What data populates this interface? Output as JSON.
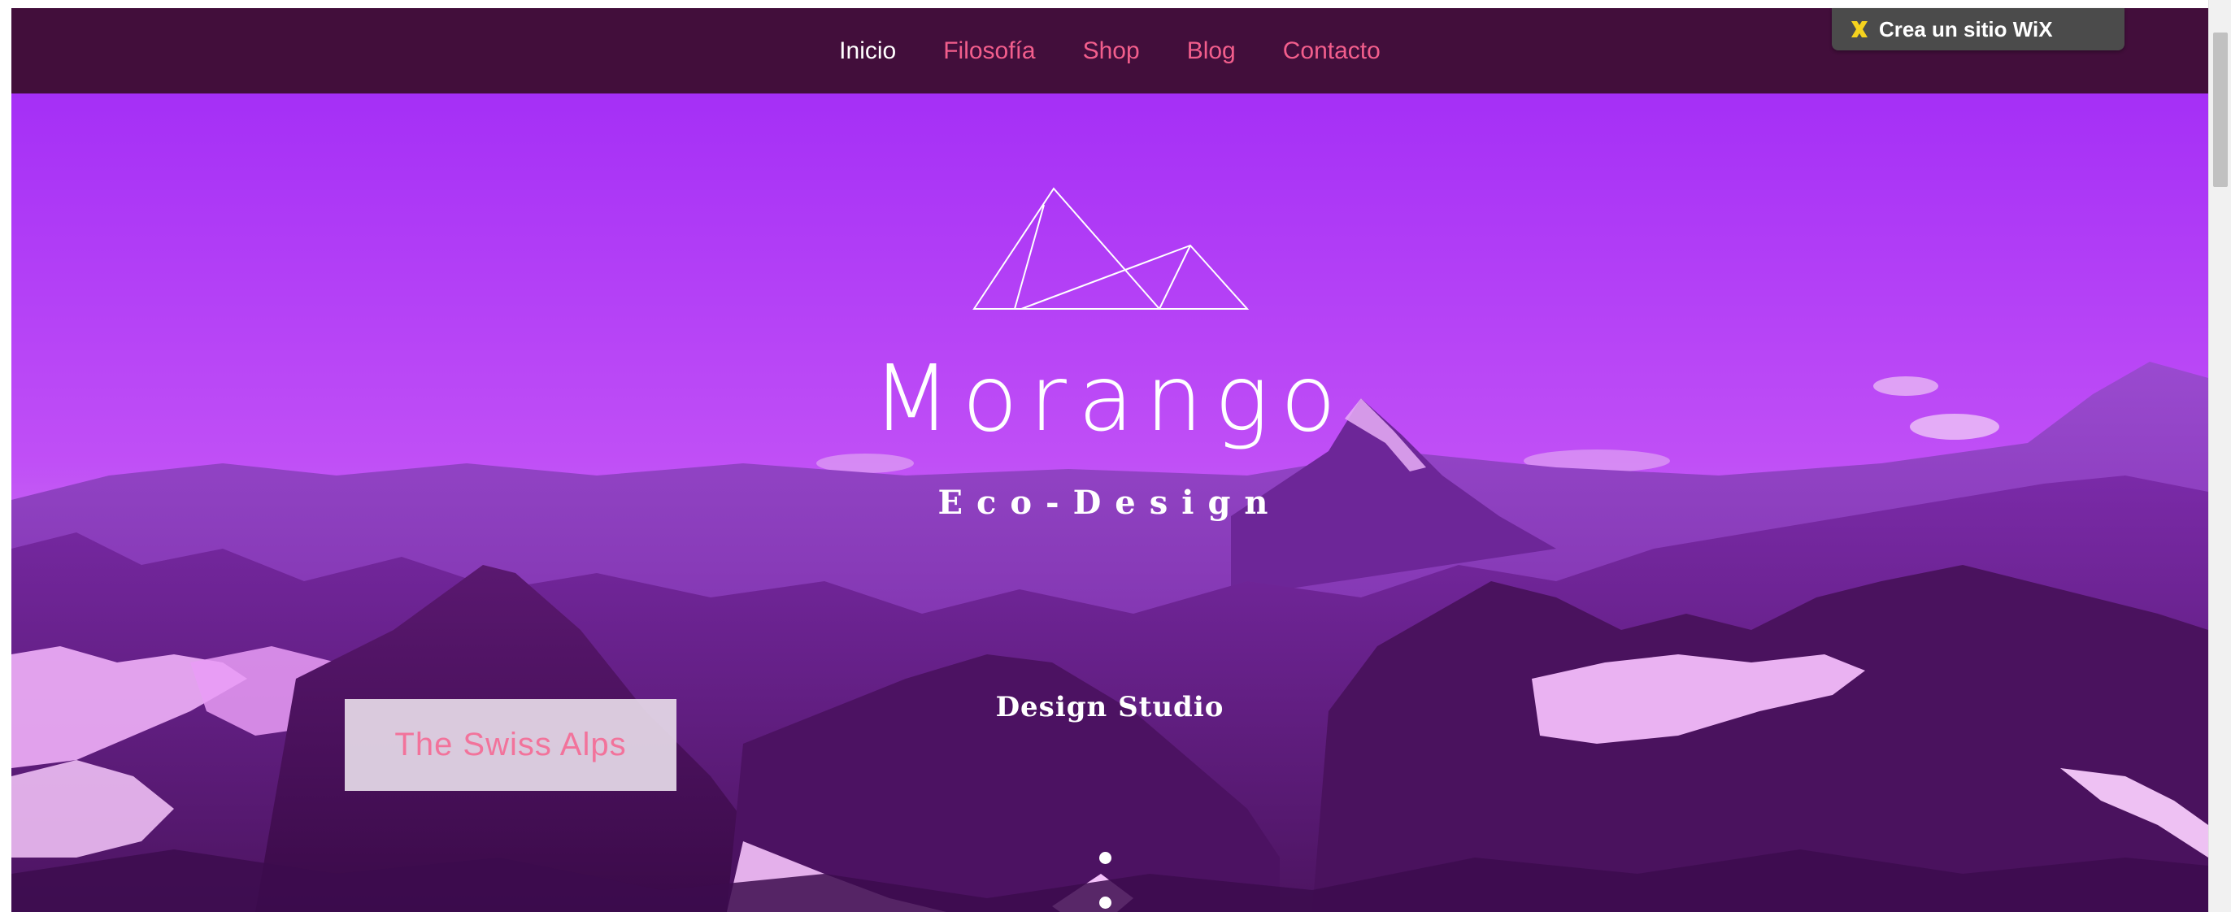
{
  "nav": {
    "items": [
      {
        "label": "Inicio",
        "active": true
      },
      {
        "label": "Filosofía",
        "active": false
      },
      {
        "label": "Shop",
        "active": false
      },
      {
        "label": "Blog",
        "active": false
      },
      {
        "label": "Contacto",
        "active": false
      }
    ]
  },
  "wix_banner": {
    "label": "Crea un sitio WiX",
    "icon": "wix-x-icon"
  },
  "hero": {
    "logo_icon": "mountains-outline-logo",
    "title": "Morango",
    "subtitle": "Eco-Design",
    "tagline": "Design Studio",
    "caption": "The Swiss Alps",
    "slide_count": 2,
    "current_slide": 1
  },
  "colors": {
    "navbar_bg": "#420e3b",
    "nav_link": "#f25e8c",
    "nav_active": "#ffffff",
    "hero_tint": "#a830f5",
    "caption_text": "#f2739b"
  }
}
